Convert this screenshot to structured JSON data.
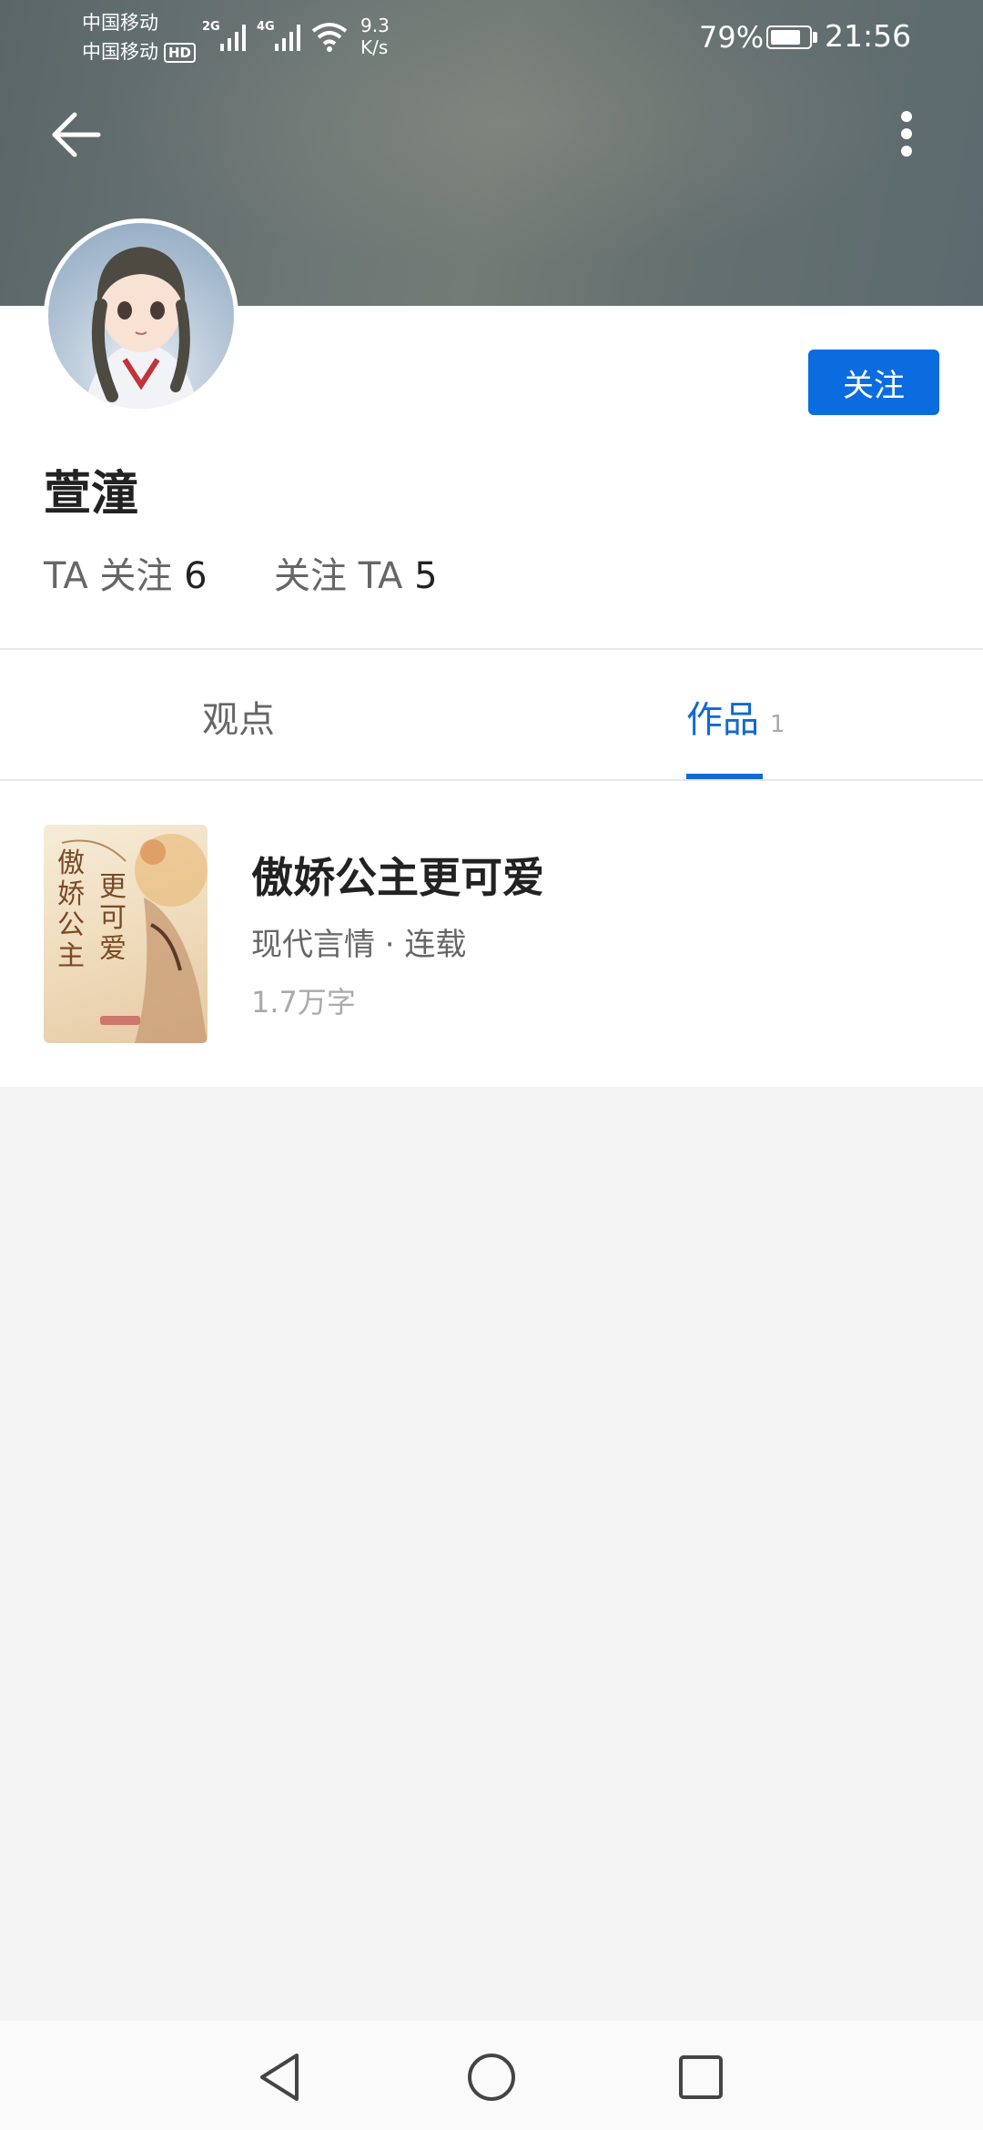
{
  "status_bar": {
    "carrier1": "中国移动",
    "carrier2": "中国移动",
    "hd": "HD",
    "net1": "2G",
    "net2": "4G",
    "speed_value": "9.3",
    "speed_unit": "K/s",
    "battery_percent_text": "79%",
    "battery_level": 0.79,
    "time": "21:56"
  },
  "header": {
    "back_icon": "arrow-left-icon",
    "more_icon": "more-vertical-icon"
  },
  "profile": {
    "name": "萱潼",
    "follow_button": "关注",
    "following_label": "TA 关注",
    "following_count": "6",
    "followers_label": "关注 TA",
    "followers_count": "5"
  },
  "tabs": [
    {
      "label": "观点",
      "count": "",
      "active": false
    },
    {
      "label": "作品",
      "count": "1",
      "active": true
    }
  ],
  "works": [
    {
      "title": "傲娇公主更可爱",
      "meta": "现代言情 · 连载",
      "words": "1.7万字",
      "cover_title_left": "傲娇公主",
      "cover_title_right": "更可爱"
    }
  ],
  "navbar": {
    "back_icon": "nav-back-icon",
    "home_icon": "nav-home-icon",
    "recent_icon": "nav-recents-icon"
  },
  "colors": {
    "accent": "#0a6cde",
    "tab_active": "#1169d4",
    "text_primary": "#222222",
    "text_secondary": "#666666",
    "text_muted": "#aaaaaa",
    "page_bg": "#f4f4f4"
  }
}
